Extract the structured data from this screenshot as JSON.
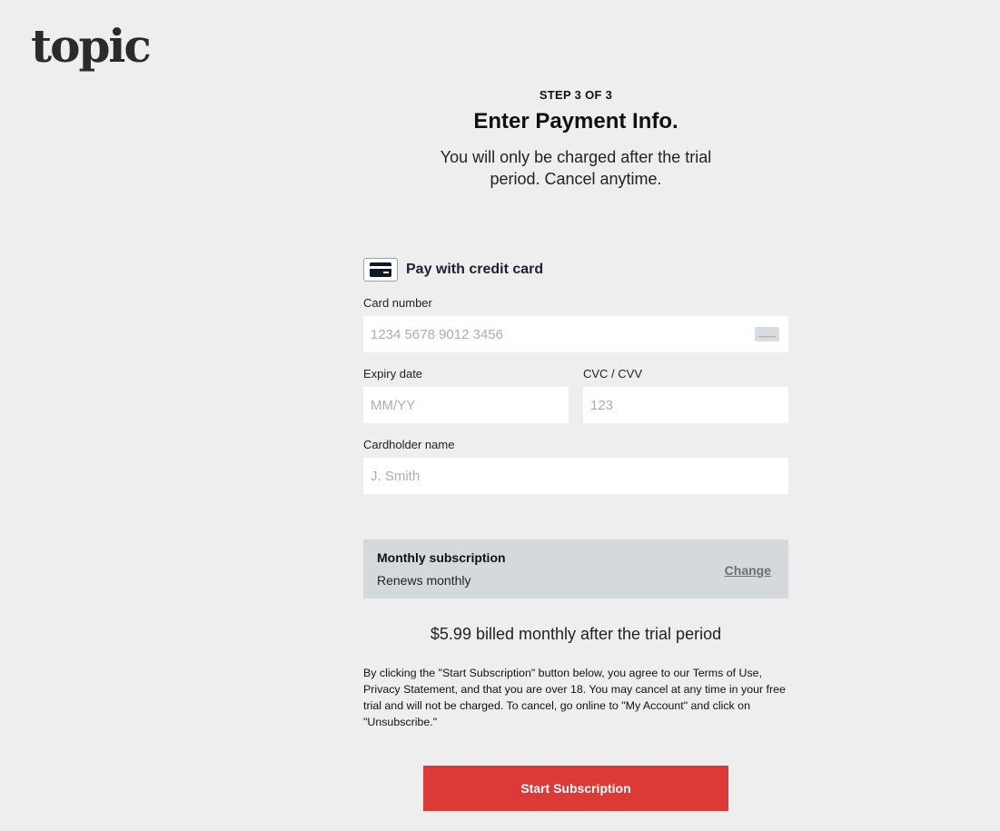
{
  "brand": {
    "logo_text": "topic"
  },
  "header": {
    "step": "STEP 3 OF 3",
    "title": "Enter Payment Info.",
    "subtitle": "You will only be charged after the trial period. Cancel anytime."
  },
  "payment_method": {
    "label": "Pay with credit card",
    "icon": "credit-card-icon"
  },
  "fields": {
    "card_number": {
      "label": "Card number",
      "placeholder": "1234 5678 9012 3456",
      "value": ""
    },
    "expiry": {
      "label": "Expiry date",
      "placeholder": "MM/YY",
      "value": ""
    },
    "cvc": {
      "label": "CVC / CVV",
      "placeholder": "123",
      "value": ""
    },
    "name": {
      "label": "Cardholder name",
      "placeholder": "J. Smith",
      "value": ""
    }
  },
  "subscription": {
    "title": "Monthly subscription",
    "renew": "Renews monthly",
    "change_label": "Change"
  },
  "price_text": "$5.99 billed monthly after the trial period",
  "terms_text": "By clicking the \"Start Subscription\" button below, you agree to our Terms of Use, Privacy Statement, and that you are over 18. You may cancel at any time in your free trial and will not be charged. To cancel, go online to \"My Account\" and click on \"Unsubscribe.\"",
  "cta_label": "Start Subscription",
  "colors": {
    "background": "#eeeeee",
    "cta": "#dc3a37",
    "summary_bg": "#d6d9dc"
  }
}
